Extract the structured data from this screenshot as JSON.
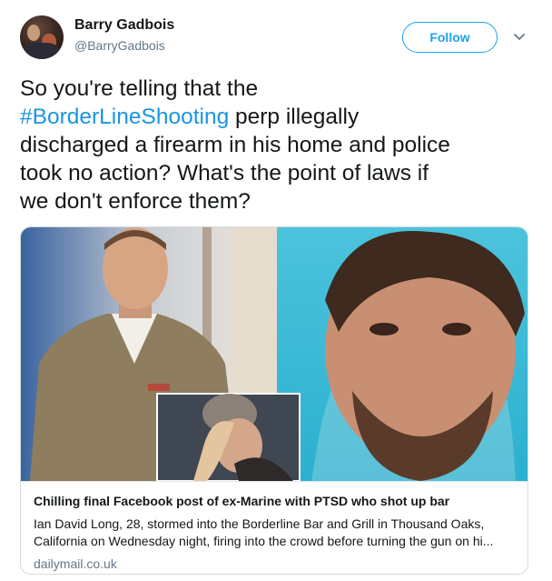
{
  "user": {
    "display_name": "Barry Gadbois",
    "handle": "@BarryGadbois",
    "avatar_icon": "profile-photo"
  },
  "actions": {
    "follow_label": "Follow",
    "more_icon": "chevron-down-icon"
  },
  "tweet": {
    "line1": "So you're telling that the",
    "hashtag": "#BorderLineShooting",
    "line2_rest": " perp illegally",
    "line3": "discharged a firearm in his home and police",
    "line4": "took no action? What's the point of laws if",
    "line5": "we don't enforce them?"
  },
  "card": {
    "title": "Chilling final Facebook post of ex-Marine with PTSD who shot up bar",
    "description_line1": "Ian David Long, 28, stormed into the Borderline Bar and Grill in Thousand Oaks,",
    "description_line2": "California on Wednesday night, firing into the crowd before turning the gun on hi...",
    "domain": "dailymail.co.uk"
  },
  "colors": {
    "link": "#1b95e0",
    "follow_border": "#1da1f2",
    "secondary_text": "#657786",
    "card_border": "#d6dbdf"
  }
}
